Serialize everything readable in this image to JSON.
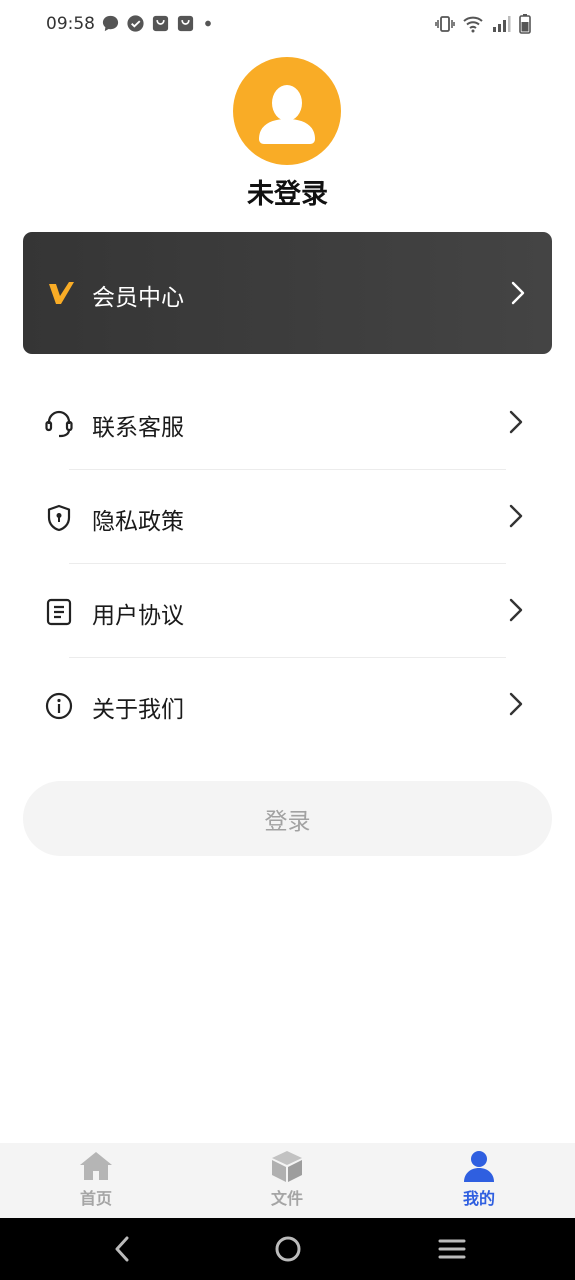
{
  "status_bar": {
    "time": "09:58"
  },
  "profile": {
    "name": "未登录"
  },
  "vip": {
    "label": "会员中心",
    "accent_color": "#f9ac26"
  },
  "menu": {
    "items": [
      {
        "label": "联系客服",
        "icon": "headset-icon"
      },
      {
        "label": "隐私政策",
        "icon": "shield-icon"
      },
      {
        "label": "用户协议",
        "icon": "document-icon"
      },
      {
        "label": "关于我们",
        "icon": "info-icon"
      }
    ]
  },
  "login": {
    "label": "登录"
  },
  "tabs": [
    {
      "label": "首页",
      "icon": "home-icon",
      "active": false
    },
    {
      "label": "文件",
      "icon": "box-icon",
      "active": false
    },
    {
      "label": "我的",
      "icon": "user-icon",
      "active": true
    }
  ],
  "colors": {
    "avatar_bg": "#f9ac26",
    "active_tab": "#2f5fe0",
    "inactive_tab": "#a5a5a5",
    "card_bg": "#3a3a3a"
  }
}
